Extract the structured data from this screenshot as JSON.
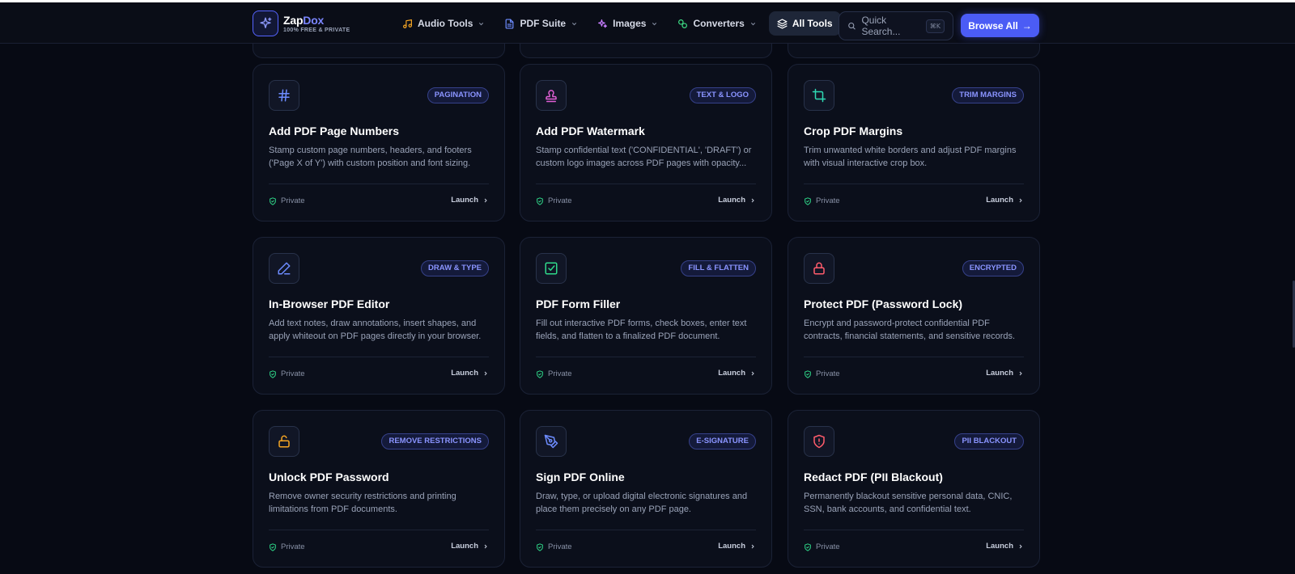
{
  "brand": {
    "name_part1": "Zap",
    "name_part2": "Dox",
    "tagline": "100% FREE & PRIVATE"
  },
  "nav": {
    "items": [
      {
        "label": "Audio Tools",
        "icon": "music-note-icon",
        "color": "#f5a524"
      },
      {
        "label": "PDF Suite",
        "icon": "file-icon",
        "color": "#6d8cff"
      },
      {
        "label": "Images",
        "icon": "sparkles-icon",
        "color": "#c77dff"
      },
      {
        "label": "Converters",
        "icon": "convert-icon",
        "color": "#3ddc84"
      },
      {
        "label": "All Tools",
        "icon": "layers-icon",
        "color": "#ffffff",
        "active": true
      }
    ]
  },
  "search": {
    "placeholder": "Quick Search...",
    "shortcut": "⌘K"
  },
  "browse_button": {
    "label": "Browse All",
    "arrow": "→"
  },
  "cards": [
    {
      "title": "Add PDF Page Numbers",
      "badge": "PAGINATION",
      "icon": "hash-icon",
      "icon_color": "#6d8cff",
      "description": "Stamp custom page numbers, headers, and footers ('Page X of Y') with custom position and font sizing.",
      "privacy": "Private",
      "action": "Launch"
    },
    {
      "title": "Add PDF Watermark",
      "badge": "TEXT & LOGO",
      "icon": "stamp-icon",
      "icon_color": "#e15fd6",
      "description": "Stamp confidential text ('CONFIDENTIAL', 'DRAFT') or custom logo images across PDF pages with opacity...",
      "privacy": "Private",
      "action": "Launch"
    },
    {
      "title": "Crop PDF Margins",
      "badge": "TRIM MARGINS",
      "icon": "crop-icon",
      "icon_color": "#2fd9b3",
      "description": "Trim unwanted white borders and adjust PDF margins with visual interactive crop box.",
      "privacy": "Private",
      "action": "Launch"
    },
    {
      "title": "In-Browser PDF Editor",
      "badge": "DRAW & TYPE",
      "icon": "pen-icon",
      "icon_color": "#6d8cff",
      "description": "Add text notes, draw annotations, insert shapes, and apply whiteout on PDF pages directly in your browser.",
      "privacy": "Private",
      "action": "Launch"
    },
    {
      "title": "PDF Form Filler",
      "badge": "FILL & FLATTEN",
      "icon": "checkbox-icon",
      "icon_color": "#2fd98a",
      "description": "Fill out interactive PDF forms, check boxes, enter text fields, and flatten to a finalized PDF document.",
      "privacy": "Private",
      "action": "Launch"
    },
    {
      "title": "Protect PDF (Password Lock)",
      "badge": "ENCRYPTED",
      "icon": "lock-icon",
      "icon_color": "#ff5c6c",
      "description": "Encrypt and password-protect confidential PDF contracts, financial statements, and sensitive records.",
      "privacy": "Private",
      "action": "Launch"
    },
    {
      "title": "Unlock PDF Password",
      "badge": "REMOVE RESTRICTIONS",
      "icon": "unlock-icon",
      "icon_color": "#f5a524",
      "description": "Remove owner security restrictions and printing limitations from PDF documents.",
      "privacy": "Private",
      "action": "Launch"
    },
    {
      "title": "Sign PDF Online",
      "badge": "E-SIGNATURE",
      "icon": "signature-pen-icon",
      "icon_color": "#6d8cff",
      "description": "Draw, type, or upload digital electronic signatures and place them precisely on any PDF page.",
      "privacy": "Private",
      "action": "Launch"
    },
    {
      "title": "Redact PDF (PII Blackout)",
      "badge": "PII BLACKOUT",
      "icon": "shield-alert-icon",
      "icon_color": "#ff5c6c",
      "description": "Permanently blackout sensitive personal data, CNIC, SSN, bank accounts, and confidential text.",
      "privacy": "Private",
      "action": "Launch"
    }
  ]
}
